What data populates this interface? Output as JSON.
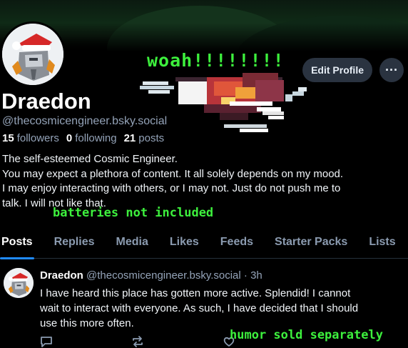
{
  "profile": {
    "display_name": "Draedon",
    "handle": "@thecosmicengineer.bsky.social",
    "followers_count": "15",
    "followers_label": "followers",
    "following_count": "0",
    "following_label": "following",
    "posts_count": "21",
    "posts_label": "posts",
    "bio_lines": [
      "The self-esteemed Cosmic Engineer.",
      "You may expect a plethora of content. It all solely depends on my mood.",
      "I may enjoy interacting with others, or I may not. Just do not push me to",
      "talk. I will not like that."
    ]
  },
  "actions": {
    "edit_profile_label": "Edit Profile",
    "more_label": "···"
  },
  "overlay": {
    "woah": "woah!!!!!!!!",
    "batteries": "batteries not included",
    "humor": "humor sold separately"
  },
  "tabs": [
    {
      "label": "Posts",
      "active": true
    },
    {
      "label": "Replies"
    },
    {
      "label": "Media"
    },
    {
      "label": "Likes"
    },
    {
      "label": "Feeds"
    },
    {
      "label": "Starter Packs"
    },
    {
      "label": "Lists"
    }
  ],
  "post": {
    "author": "Draedon",
    "handle": "@thecosmicengineer.bsky.social",
    "separator": "·",
    "time": "3h",
    "body_lines": [
      "I have heard this place has gotten more active. Splendid! I cannot",
      "wait to interact with everyone. As such, I have decided that I should",
      "use this more often."
    ],
    "icons": [
      "reply-icon",
      "repost-icon",
      "like-icon"
    ]
  },
  "colors": {
    "accent": "#208bfe",
    "overlay_green": "#3df03d",
    "button_bg": "#2a3340",
    "muted": "#94a3b8"
  }
}
